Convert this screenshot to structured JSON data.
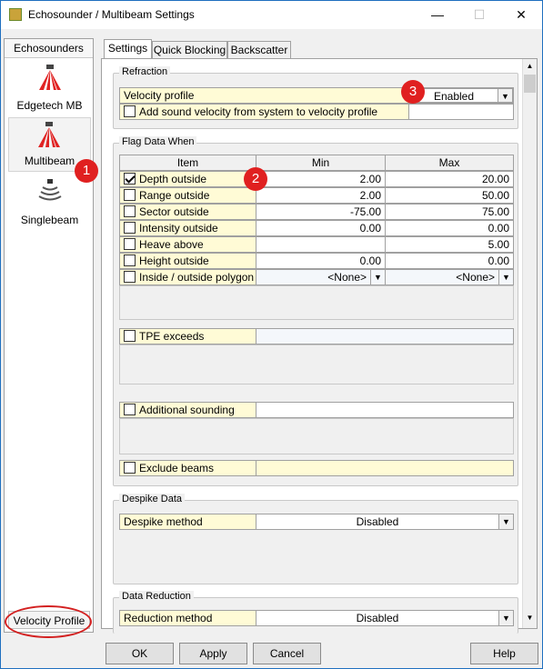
{
  "window": {
    "title": "Echosounder / Multibeam Settings",
    "min": "—",
    "max": "☐",
    "close": "✕"
  },
  "sidebar": {
    "header": "Echosounders",
    "items": [
      {
        "label": "Edgetech MB"
      },
      {
        "label": "Multibeam"
      },
      {
        "label": "Singlebeam"
      }
    ],
    "velocity_profile": "Velocity Profile"
  },
  "tabs": [
    "Settings",
    "Quick Blocking",
    "Backscatter"
  ],
  "refraction": {
    "group": "Refraction",
    "velocity_profile_label": "Velocity profile",
    "velocity_profile_value": "Enabled",
    "add_sound_label": "Add sound velocity from system to velocity profile"
  },
  "flag": {
    "group": "Flag Data When",
    "headers": [
      "Item",
      "Min",
      "Max"
    ],
    "rows": [
      {
        "label": "Depth outside",
        "min": "2.00",
        "max": "20.00",
        "checked": true
      },
      {
        "label": "Range outside",
        "min": "2.00",
        "max": "50.00",
        "checked": false
      },
      {
        "label": "Sector outside",
        "min": "-75.00",
        "max": "75.00",
        "checked": false
      },
      {
        "label": "Intensity outside",
        "min": "0.00",
        "max": "0.00",
        "checked": false
      },
      {
        "label": "Heave above",
        "min": "",
        "max": "5.00",
        "checked": false
      },
      {
        "label": "Height outside",
        "min": "0.00",
        "max": "0.00",
        "checked": false
      },
      {
        "label": "Inside / outside polygon",
        "min": "<None>",
        "max": "<None>",
        "checked": false
      }
    ],
    "tpe": "TPE exceeds",
    "additional": "Additional sounding",
    "exclude": "Exclude beams"
  },
  "despike": {
    "group": "Despike Data",
    "label": "Despike method",
    "value": "Disabled"
  },
  "reduction": {
    "group": "Data Reduction",
    "label": "Reduction method",
    "value": "Disabled"
  },
  "badges": [
    "1",
    "2",
    "3"
  ],
  "buttons": {
    "ok": "OK",
    "apply": "Apply",
    "cancel": "Cancel",
    "help": "Help"
  }
}
